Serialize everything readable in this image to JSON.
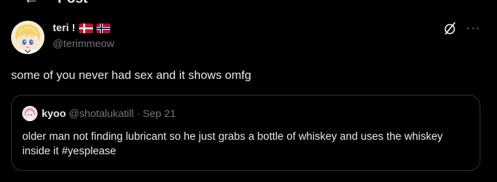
{
  "header": {
    "back_glyph": "←",
    "title": "Post"
  },
  "post": {
    "display_name": "teri !",
    "flags": [
      "denmark-flag",
      "norway-flag"
    ],
    "handle": "@terimmeow",
    "text": "some of you never had sex and it shows omfg",
    "more_glyph": "···"
  },
  "quote": {
    "display_name": "kyoo",
    "handle": "@shotalukatill",
    "separator": "·",
    "date": "Sep 21",
    "text": "older man not finding lubricant so he just grabs a bottle of whiskey and uses the whiskey inside it #yesplease"
  },
  "colors": {
    "background": "#000000",
    "text_primary": "#e7e9ea",
    "text_secondary": "#71767b",
    "border": "#2f3336"
  }
}
